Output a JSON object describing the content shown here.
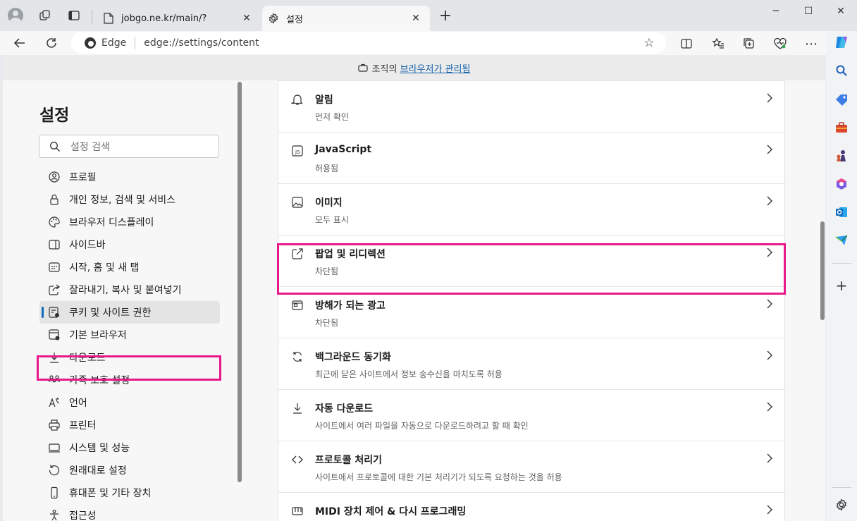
{
  "window": {
    "tabs": [
      {
        "title": "jobgo.ne.kr/main/?",
        "active": false
      },
      {
        "title": "설정",
        "active": true
      }
    ],
    "controls": {
      "minimize": "─",
      "maximize": "☐",
      "close": "✕"
    }
  },
  "toolbar": {
    "address_brand": "Edge",
    "address_url": "edge://settings/content"
  },
  "infobar": {
    "prefix": "조직의",
    "link": "브라우저가 관리됨"
  },
  "sidebar": {
    "title": "설정",
    "search_placeholder": "설정 검색",
    "items": [
      {
        "label": "프로필",
        "icon": "profile-icon"
      },
      {
        "label": "개인 정보, 검색 및 서비스",
        "icon": "lock-icon"
      },
      {
        "label": "브라우저 디스플레이",
        "icon": "palette-icon"
      },
      {
        "label": "사이드바",
        "icon": "sidebar-icon"
      },
      {
        "label": "시작, 홈 및 새 탭",
        "icon": "home-tab-icon"
      },
      {
        "label": "잘라내기, 복사 및 붙여넣기",
        "icon": "share-icon"
      },
      {
        "label": "쿠키 및 사이트 권한",
        "icon": "cookie-icon",
        "selected": true
      },
      {
        "label": "기본 브라우저",
        "icon": "browser-icon"
      },
      {
        "label": "다운로드",
        "icon": "download-icon"
      },
      {
        "label": "가족 보호 설정",
        "icon": "family-icon"
      },
      {
        "label": "언어",
        "icon": "language-icon"
      },
      {
        "label": "프린터",
        "icon": "printer-icon"
      },
      {
        "label": "시스템 및 성능",
        "icon": "system-icon"
      },
      {
        "label": "원래대로 설정",
        "icon": "reset-icon"
      },
      {
        "label": "휴대폰 및 기타 장치",
        "icon": "phone-icon"
      },
      {
        "label": "접근성",
        "icon": "accessibility-icon"
      }
    ]
  },
  "settings_rows": [
    {
      "title": "알림",
      "subtitle": "먼저 확인",
      "icon": "bell-icon"
    },
    {
      "title": "JavaScript",
      "subtitle": "허용됨",
      "icon": "javascript-icon"
    },
    {
      "title": "이미지",
      "subtitle": "모두 표시",
      "icon": "image-icon"
    },
    {
      "title": "팝업 및 리디렉션",
      "subtitle": "차단됨",
      "icon": "popup-icon",
      "highlighted": true
    },
    {
      "title": "방해가 되는 광고",
      "subtitle": "차단됨",
      "icon": "ads-icon"
    },
    {
      "title": "백그라운드 동기화",
      "subtitle": "최근에 닫은 사이트에서 정보 송수신을 마치도록 허용",
      "icon": "sync-icon"
    },
    {
      "title": "자동 다운로드",
      "subtitle": "사이트에서 여러 파일을 자동으로 다운로드하려고 할 때 확인",
      "icon": "download-icon"
    },
    {
      "title": "프로토콜 처리기",
      "subtitle": "사이트에서 프로토콜에 대한 기본 처리기가 되도록 요청하는 것을 허용",
      "icon": "protocol-icon"
    },
    {
      "title": "MIDI 장치 제어 & 다시 프로그래밍",
      "subtitle": "",
      "icon": "midi-icon"
    }
  ],
  "colors": {
    "highlight": "#e8178a",
    "accent": "#0f6cbd",
    "link": "#0f5da8"
  }
}
